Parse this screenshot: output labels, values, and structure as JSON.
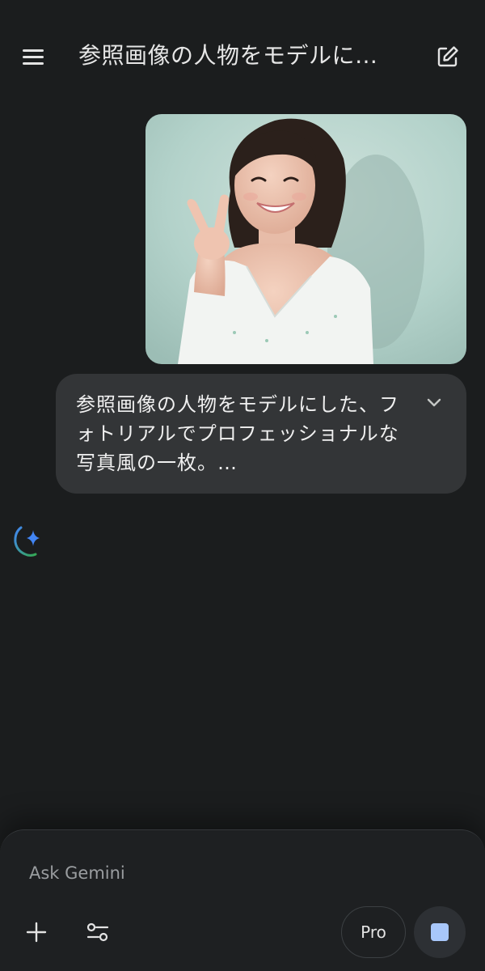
{
  "header": {
    "title": "参照画像の人物をモデルに…",
    "menu_icon": "hamburger-menu-icon",
    "edit_icon": "new-chat-edit-icon"
  },
  "conversation": {
    "user_image": {
      "kind": "photo"
    },
    "user_prompt": {
      "text": "参照画像の人物をモデルにした、フォトリアルでプロフェッショナルな写真風の一枚。…",
      "expand_icon": "chevron-down-icon"
    },
    "response": {
      "state": "generating",
      "icon": "gemini-sparkle-icon"
    }
  },
  "composer": {
    "placeholder": "Ask Gemini",
    "value": "",
    "add_icon": "plus-icon",
    "tools_icon": "tools-sliders-icon",
    "model_label": "Pro",
    "stop_icon": "stop-icon"
  },
  "colors": {
    "background": "#1b1d1e",
    "bubble": "#333537",
    "accent_blue": "#a8c7fa",
    "sparkle_blue": "#4285f4"
  }
}
